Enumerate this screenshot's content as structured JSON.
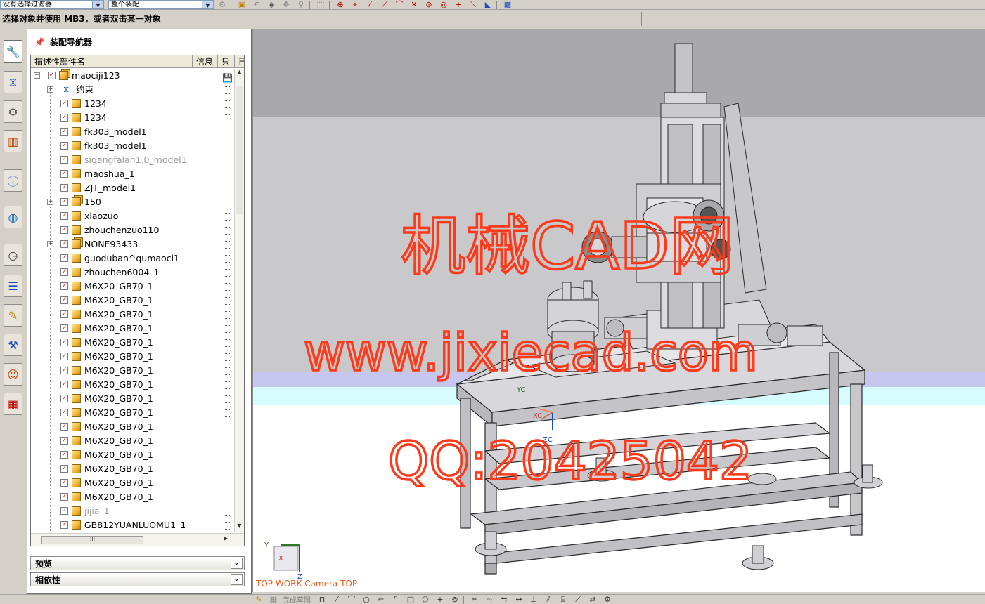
{
  "toolbar": {
    "selection_filter": "没有选择过滤器",
    "scope": "整个装配"
  },
  "prompt": {
    "text": "选择对象并使用 MB3，或者双击某一对象"
  },
  "navigator": {
    "title": "装配导航器",
    "columns": {
      "name": "描述性部件名",
      "info": "信息",
      "readonly": "只",
      "extra": "已"
    },
    "rows": [
      {
        "label": "maocijī123",
        "level": 0,
        "type": "asm",
        "expander": "−",
        "checked": true,
        "greyed": false
      },
      {
        "label": "约束",
        "level": 1,
        "type": "cons",
        "expander": "+",
        "checked": null,
        "greyed": false
      },
      {
        "label": "1234",
        "level": 2,
        "type": "part",
        "checked": true,
        "greyed": false
      },
      {
        "label": "1234",
        "level": 2,
        "type": "part",
        "checked": true,
        "greyed": false
      },
      {
        "label": "fk303_model1",
        "level": 2,
        "type": "part",
        "checked": true,
        "greyed": false
      },
      {
        "label": "fk303_model1",
        "level": 2,
        "type": "part",
        "checked": true,
        "greyed": false
      },
      {
        "label": "sigangfalan1.0_model1",
        "level": 2,
        "type": "part",
        "checked": true,
        "greyed": true
      },
      {
        "label": "maoshua_1",
        "level": 2,
        "type": "part",
        "checked": true,
        "greyed": false
      },
      {
        "label": "ZJT_model1",
        "level": 2,
        "type": "part",
        "checked": true,
        "greyed": false
      },
      {
        "label": "150",
        "level": 2,
        "type": "asm",
        "expander": "+",
        "checked": true,
        "greyed": false
      },
      {
        "label": "xiaozuo",
        "level": 2,
        "type": "part",
        "checked": true,
        "greyed": false
      },
      {
        "label": "zhouchenzuo110",
        "level": 2,
        "type": "part",
        "checked": true,
        "greyed": false
      },
      {
        "label": "NONE93433",
        "level": 2,
        "type": "asm",
        "expander": "+",
        "checked": true,
        "greyed": false
      },
      {
        "label": "guoduban^qumaoci1",
        "level": 2,
        "type": "part",
        "checked": true,
        "greyed": false
      },
      {
        "label": "zhouchen6004_1",
        "level": 2,
        "type": "part",
        "checked": true,
        "greyed": false
      },
      {
        "label": "M6X20_GB70_1",
        "level": 2,
        "type": "part",
        "checked": true,
        "greyed": false
      },
      {
        "label": "M6X20_GB70_1",
        "level": 2,
        "type": "part",
        "checked": true,
        "greyed": false
      },
      {
        "label": "M6X20_GB70_1",
        "level": 2,
        "type": "part",
        "checked": true,
        "greyed": false
      },
      {
        "label": "M6X20_GB70_1",
        "level": 2,
        "type": "part",
        "checked": true,
        "greyed": false
      },
      {
        "label": "M6X20_GB70_1",
        "level": 2,
        "type": "part",
        "checked": true,
        "greyed": false
      },
      {
        "label": "M6X20_GB70_1",
        "level": 2,
        "type": "part",
        "checked": true,
        "greyed": false
      },
      {
        "label": "M6X20_GB70_1",
        "level": 2,
        "type": "part",
        "checked": true,
        "greyed": false
      },
      {
        "label": "M6X20_GB70_1",
        "level": 2,
        "type": "part",
        "checked": true,
        "greyed": false
      },
      {
        "label": "M6X20_GB70_1",
        "level": 2,
        "type": "part",
        "checked": true,
        "greyed": false
      },
      {
        "label": "M6X20_GB70_1",
        "level": 2,
        "type": "part",
        "checked": true,
        "greyed": false
      },
      {
        "label": "M6X20_GB70_1",
        "level": 2,
        "type": "part",
        "checked": true,
        "greyed": false
      },
      {
        "label": "M6X20_GB70_1",
        "level": 2,
        "type": "part",
        "checked": true,
        "greyed": false
      },
      {
        "label": "M6X20_GB70_1",
        "level": 2,
        "type": "part",
        "checked": true,
        "greyed": false
      },
      {
        "label": "M6X20_GB70_1",
        "level": 2,
        "type": "part",
        "checked": true,
        "greyed": false
      },
      {
        "label": "M6X20_GB70_1",
        "level": 2,
        "type": "part",
        "checked": true,
        "greyed": false
      },
      {
        "label": "M6X20_GB70_1",
        "level": 2,
        "type": "part",
        "checked": true,
        "greyed": false
      },
      {
        "label": "jijia_1",
        "level": 2,
        "type": "part",
        "checked": true,
        "greyed": true
      },
      {
        "label": "GB812YUANLUOMU1_1",
        "level": 2,
        "type": "part",
        "checked": true,
        "greyed": false
      }
    ],
    "hscroll_grip": "III",
    "preview_label": "预览",
    "dependency_label": "相依性"
  },
  "viewport": {
    "view_label": "TOP WORK Camera TOP",
    "watermark_lines": [
      "机械CAD网",
      "www.jixiecad.com",
      "QQ:20425042"
    ],
    "wcs_axes": {
      "x": "XC",
      "y": "YC",
      "z": "ZC"
    },
    "triad_axes": {
      "x": "X",
      "y": "Y",
      "z": "Z"
    },
    "background_colors": {
      "top": "#a9a9ab",
      "mid": "#c9c9cb",
      "violet": "#c6c6f0",
      "cyan": "#d6fbff",
      "floor": "#ffffff"
    },
    "watermark_color": "#ff3a1a"
  },
  "bottom_toolbar": {
    "sketch_label": "完成草图"
  }
}
